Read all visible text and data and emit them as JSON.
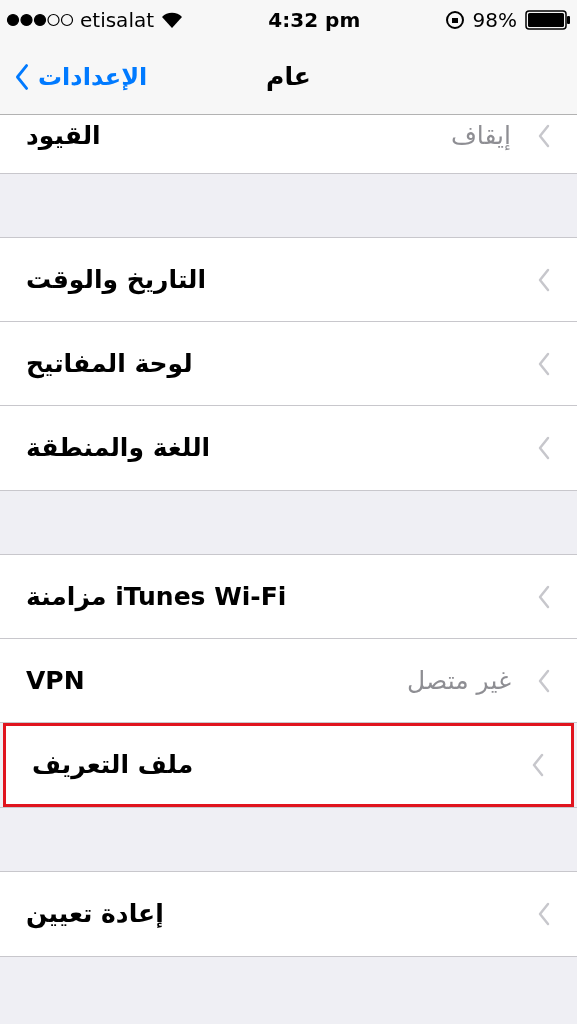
{
  "status_bar": {
    "carrier": "etisalat",
    "time": "4:32 pm",
    "battery": "98%"
  },
  "nav": {
    "back": "الإعدادات",
    "title": "عام"
  },
  "groups": [
    {
      "rows": [
        {
          "label": "القيود",
          "value": "إيقاف",
          "highlighted": false
        }
      ]
    },
    {
      "rows": [
        {
          "label": "التاريخ والوقت",
          "highlighted": false
        },
        {
          "label": "لوحة المفاتيح",
          "highlighted": false
        },
        {
          "label": "اللغة والمنطقة",
          "highlighted": false
        }
      ]
    },
    {
      "rows": [
        {
          "label": "مزامنة iTunes Wi-Fi",
          "highlighted": false
        },
        {
          "label": "VPN",
          "value": "غير متصل",
          "highlighted": false
        },
        {
          "label": "ملف التعريف",
          "highlighted": true
        }
      ]
    },
    {
      "rows": [
        {
          "label": "إعادة تعيين",
          "highlighted": false
        }
      ]
    }
  ]
}
